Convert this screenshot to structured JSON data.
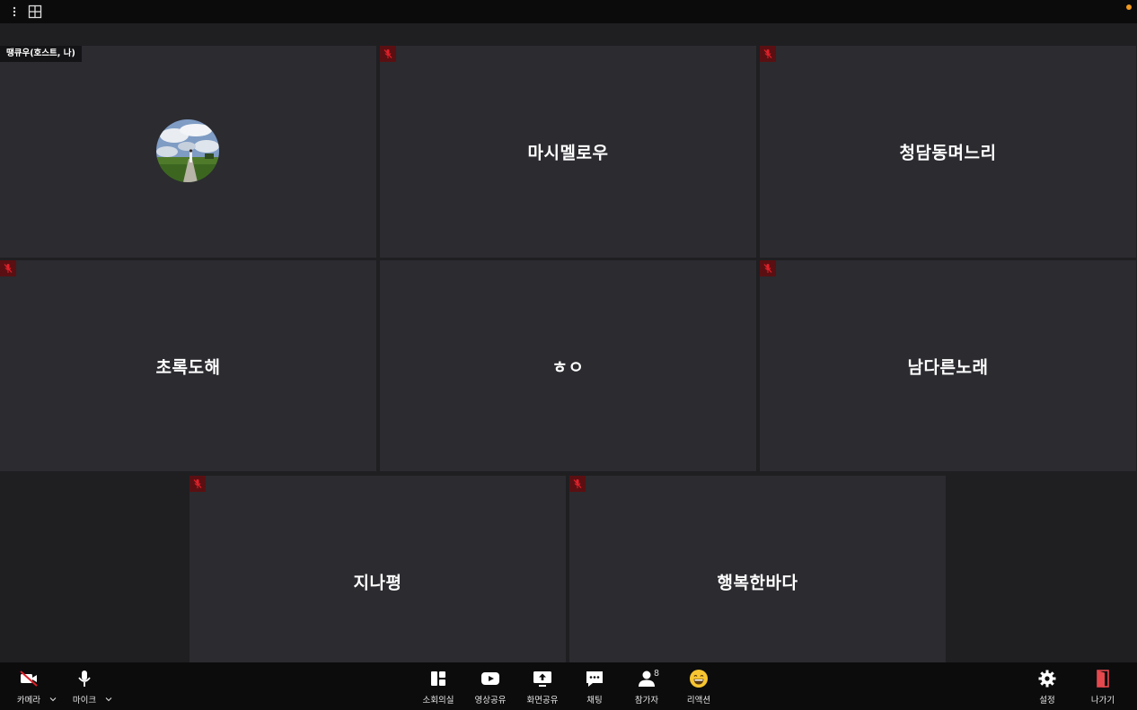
{
  "header": {
    "more_icon": "vertical-dots-icon",
    "layout_icon": "grid-layout-icon",
    "status_color": "#f29a1f"
  },
  "participants": [
    {
      "name": "",
      "host_label": "땡큐우(호스트, 나)",
      "avatar": "landscape-photo",
      "muted": false
    },
    {
      "name": "마시멜로우",
      "muted": true
    },
    {
      "name": "청담동며느리",
      "muted": true
    },
    {
      "name": "초록도해",
      "muted": true
    },
    {
      "name": "ㅎㅇ",
      "muted": false
    },
    {
      "name": "남다른노래",
      "muted": true
    },
    {
      "name": "지나평",
      "muted": true
    },
    {
      "name": "행복한바다",
      "muted": true
    }
  ],
  "toolbar": {
    "camera": "카메라",
    "mic": "마이크",
    "breakout": "소회의실",
    "video_share": "영상공유",
    "screen_share": "화면공유",
    "chat": "채팅",
    "participants": "참가자",
    "participants_count": "8",
    "reaction": "리액션",
    "settings": "설정",
    "leave": "나가기"
  },
  "colors": {
    "tile_bg": "#2b2b30",
    "mute_bg": "#5a1012",
    "mute_icon": "#e0202a",
    "leave_icon": "#e5484d"
  }
}
